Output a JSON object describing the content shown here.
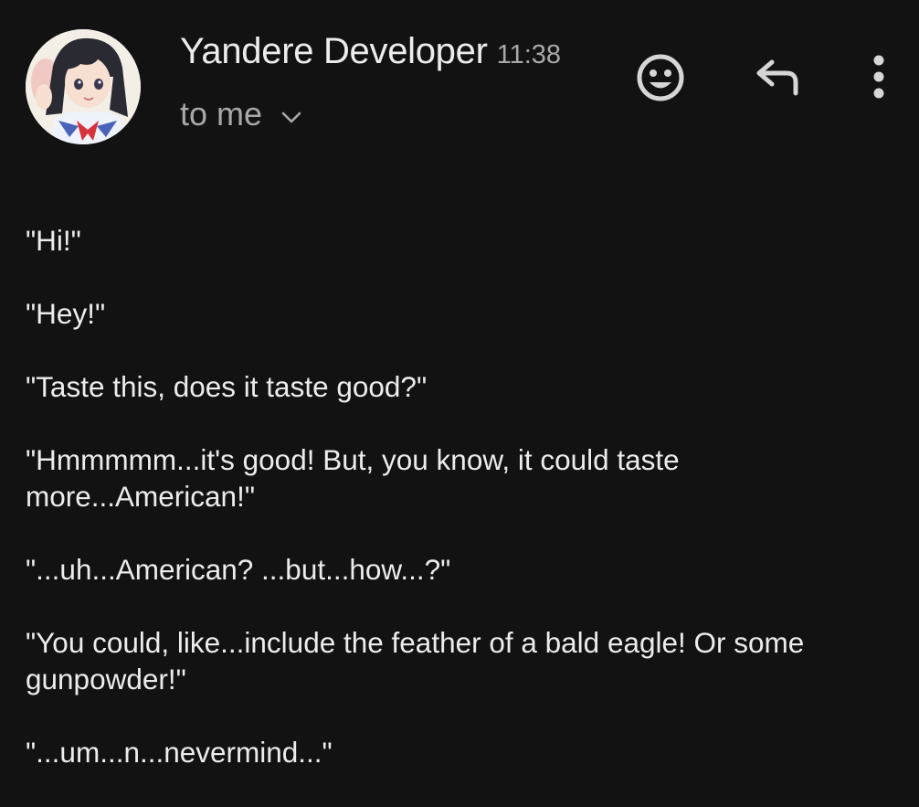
{
  "header": {
    "sender_name": "Yandere Developer",
    "time": "11:38",
    "recipient": "to me",
    "icons": {
      "avatar": "profile-avatar",
      "emoji": "smiley-face-icon",
      "reply": "reply-arrow-icon",
      "more": "vertical-dots-icon",
      "expand": "chevron-down-icon"
    }
  },
  "message": {
    "lines": [
      "\"Hi!\"",
      "\"Hey!\"",
      "\"Taste this, does it taste good?\"",
      "\"Hmmmmm...it's good! But, you know, it could taste more...American!\"",
      "\"...uh...American? ...but...how...?\"",
      "\"You could, like...include the feather of a bald eagle! Or some gunpowder!\"",
      "\"...um...n...nevermind...\""
    ]
  },
  "colors": {
    "background": "#121212",
    "primary_text": "#ececec",
    "secondary_text": "#a8a8a8",
    "icon": "#d6d6d6"
  }
}
